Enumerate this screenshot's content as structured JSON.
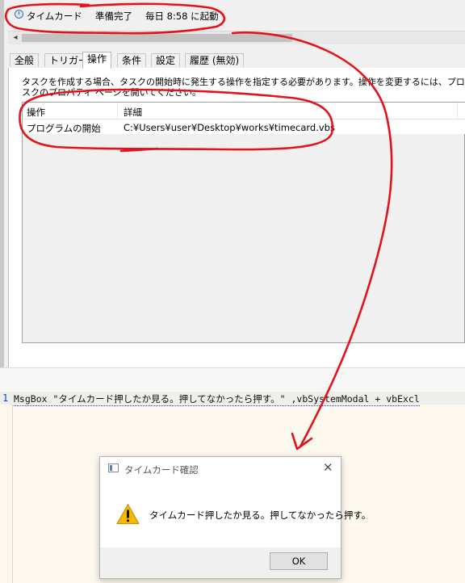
{
  "task": {
    "name": "タイムカード",
    "status": "準備完了",
    "trigger": "毎日 8:58 に起動"
  },
  "tabs": [
    {
      "label": "全般"
    },
    {
      "label": "トリガー"
    },
    {
      "label": "操作",
      "active": true
    },
    {
      "label": "条件"
    },
    {
      "label": "設定"
    },
    {
      "label": "履歴 (無効)"
    }
  ],
  "description": {
    "line1": "タスクを作成する場合、タスクの開始時に発生する操作を指定する必要があります。操作を変更するには、プロパティのコ",
    "line2": "スクのプロパティ ページを開いてください。"
  },
  "actions_table": {
    "headers": {
      "action": "操作",
      "details": "詳細"
    },
    "rows": [
      {
        "action": "プログラムの開始",
        "details": "C:¥Users¥user¥Desktop¥works¥timecard.vbs"
      }
    ]
  },
  "code": {
    "line_number": "1",
    "text": "MsgBox \"タイムカード押したか見る。押してなかったら押す。\" ,vbSystemModal + vbExcl"
  },
  "msgbox": {
    "title": "タイムカード確認",
    "message": "タイムカード押したか見る。押してなかったら押す。",
    "ok_label": "OK",
    "close_glyph": "✕"
  },
  "colors": {
    "annotation": "#e3121b",
    "warning": "#f5b800",
    "code_background": "#fdf8ee"
  },
  "icons": {
    "scroll_left": "◂"
  }
}
